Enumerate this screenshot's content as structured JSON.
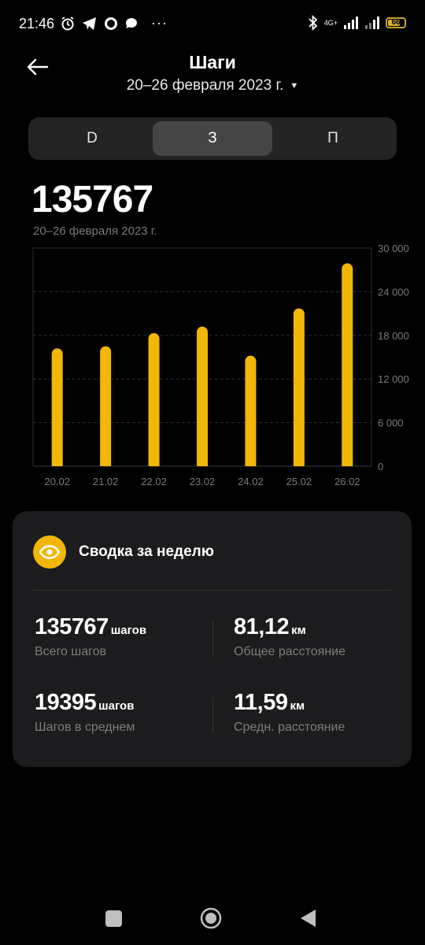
{
  "status_bar": {
    "time": "21:46",
    "network": "4G+",
    "battery": "66"
  },
  "header": {
    "title": "Шаги",
    "period": "20–26 февраля 2023 г."
  },
  "tabs": [
    {
      "label": "D",
      "active": false
    },
    {
      "label": "З",
      "active": true
    },
    {
      "label": "П",
      "active": false
    }
  ],
  "summary_total": {
    "value": "135767",
    "range": "20–26 февраля 2023 г."
  },
  "chart_data": {
    "type": "bar",
    "categories": [
      "20.02",
      "21.02",
      "22.02",
      "23.02",
      "24.02",
      "25.02",
      "26.02"
    ],
    "values": [
      16200,
      16500,
      18300,
      19200,
      15200,
      21700,
      27900
    ],
    "ylim": [
      0,
      30000
    ],
    "yticks": [
      "0",
      "6 000",
      "12 000",
      "18 000",
      "24 000",
      "30 000"
    ],
    "ytick_values": [
      0,
      6000,
      12000,
      18000,
      24000,
      30000
    ],
    "bar_color": "#F2B705",
    "grid": true
  },
  "weekly_card": {
    "title": "Сводка за неделю",
    "icon": "eye-icon",
    "accent": "#F2B705",
    "metrics": [
      {
        "value": "135767",
        "unit": "шагов",
        "label": "Всего шагов"
      },
      {
        "value": "81,12",
        "unit": "км",
        "label": "Общее расстояние"
      },
      {
        "value": "19395",
        "unit": "шагов",
        "label": "Шагов в среднем"
      },
      {
        "value": "11,59",
        "unit": "км",
        "label": "Средн. расстояние"
      }
    ]
  }
}
